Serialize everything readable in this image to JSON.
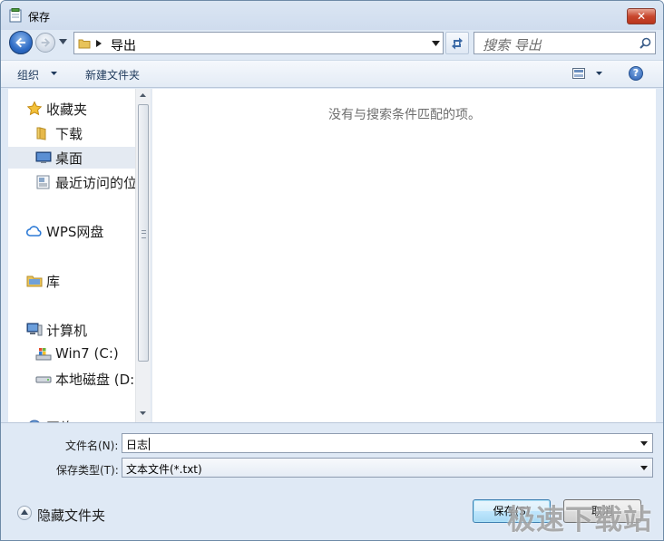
{
  "window": {
    "title": "保存"
  },
  "nav": {
    "address_segment": "导出",
    "search_placeholder": "搜索 导出"
  },
  "toolbar": {
    "organize_label": "组织",
    "new_folder_label": "新建文件夹",
    "help_label": "?"
  },
  "sidebar": {
    "items": [
      {
        "label": "收藏夹",
        "icon": "star-icon"
      },
      {
        "label": "下载",
        "icon": "folder-icon"
      },
      {
        "label": "桌面",
        "icon": "desktop-icon",
        "selected": true
      },
      {
        "label": "最近访问的位",
        "icon": "recent-places-icon"
      },
      {
        "label": "WPS网盘",
        "icon": "cloud-icon"
      },
      {
        "label": "库",
        "icon": "library-icon"
      },
      {
        "label": "计算机",
        "icon": "computer-icon"
      },
      {
        "label": "Win7 (C:)",
        "icon": "system-drive-icon"
      },
      {
        "label": "本地磁盘 (D:",
        "icon": "disk-drive-icon"
      },
      {
        "label": "网络",
        "icon": "network-icon"
      }
    ]
  },
  "content": {
    "empty_message": "没有与搜索条件匹配的项。"
  },
  "form": {
    "filename_label": "文件名(N):",
    "filename_value": "日志",
    "filetype_label": "保存类型(T):",
    "filetype_value": "文本文件(*.txt)"
  },
  "footer": {
    "hide_folders_label": "隐藏文件夹",
    "save_label": "保存(S)",
    "cancel_label": "取消"
  },
  "watermark": "极速下载站",
  "colors": {
    "selection": "#e4eaf2",
    "close_button": "#c8472e",
    "accent_blue": "#2d6bc5"
  }
}
